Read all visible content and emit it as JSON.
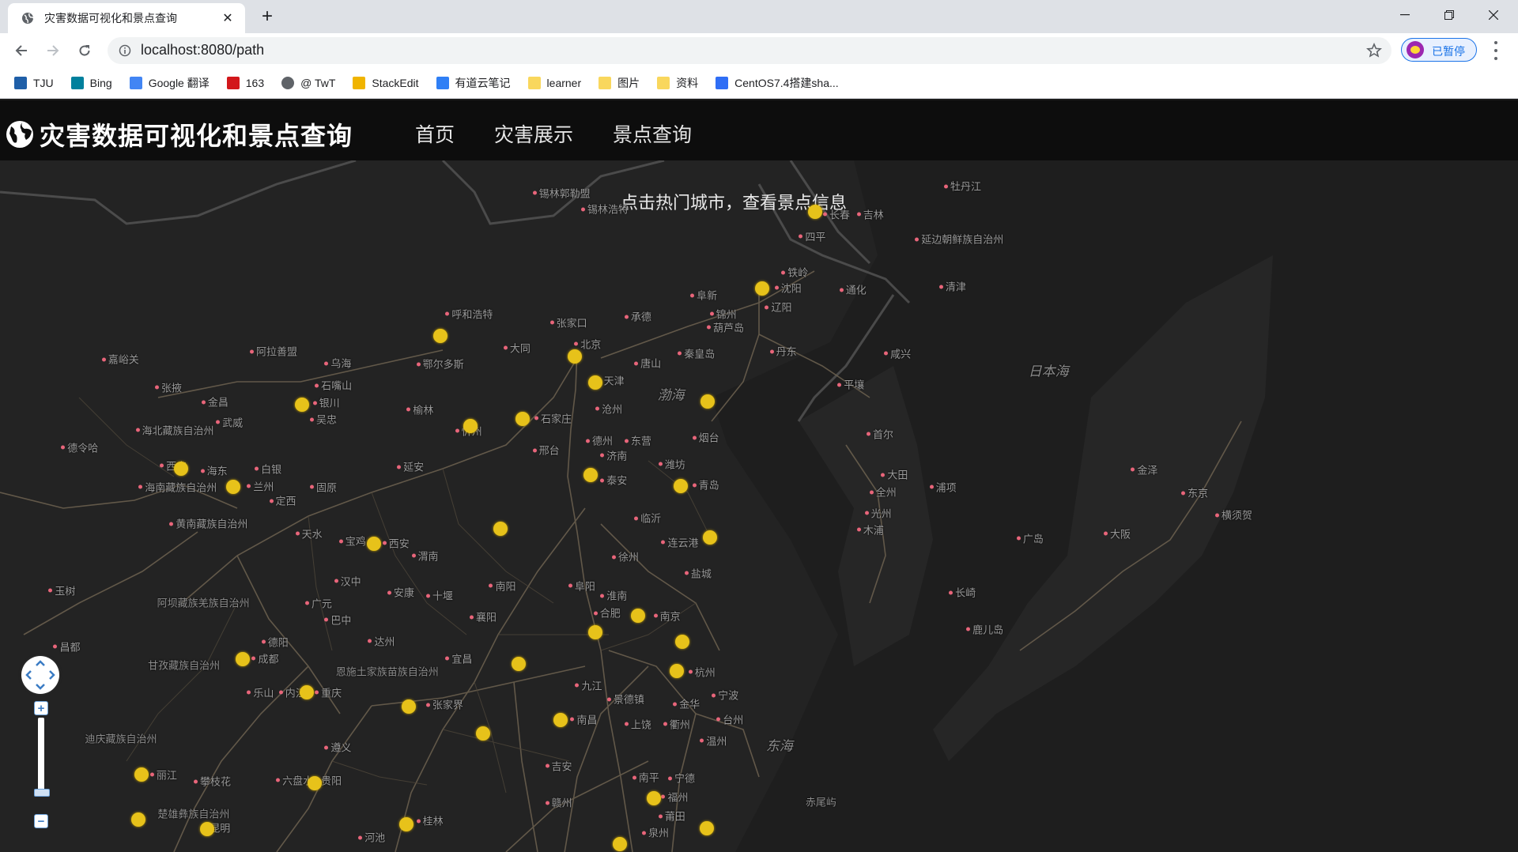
{
  "browser": {
    "tab_title": "灾害数据可视化和景点查询",
    "new_tab_label": "+",
    "url": "localhost:8080/path",
    "profile_label": "已暂停",
    "bookmarks": [
      {
        "label": "TJU",
        "icon": "tju-icon"
      },
      {
        "label": "Bing",
        "icon": "bing-icon"
      },
      {
        "label": "Google 翻译",
        "icon": "google-translate-icon"
      },
      {
        "label": "163",
        "icon": "netease-icon"
      },
      {
        "label": "@ TwT",
        "icon": "globe-icon"
      },
      {
        "label": "StackEdit",
        "icon": "stackedit-icon"
      },
      {
        "label": "有道云笔记",
        "icon": "youdao-note-icon"
      },
      {
        "label": "learner",
        "icon": "folder-icon"
      },
      {
        "label": "图片",
        "icon": "folder-icon"
      },
      {
        "label": "资料",
        "icon": "folder-icon"
      },
      {
        "label": "CentOS7.4搭建sha...",
        "icon": "bookmark-page-icon"
      }
    ]
  },
  "app": {
    "title": "灾害数据可视化和景点查询",
    "nav": [
      "首页",
      "灾害展示",
      "景点查询"
    ]
  },
  "map": {
    "title": "点击热门城市，查看景点信息",
    "hot_city_color": "#e7c21a",
    "labels": [
      "锡林郭勒盟",
      "锡林浩特",
      "长春",
      "吉林",
      "牡丹江",
      "延边朝鲜族自治州",
      "铁岭",
      "四平",
      "沈阳",
      "通化",
      "清津",
      "辽阳",
      "阜新",
      "锦州",
      "葫芦岛",
      "承德",
      "张家口",
      "呼和浩特",
      "鄂尔多斯",
      "乌海",
      "阿拉善盟",
      "嘉峪关",
      "张掖",
      "金昌",
      "武威",
      "石嘴山",
      "银川",
      "吴忠",
      "海北藏族自治州",
      "德令哈",
      "西宁",
      "海东",
      "兰州",
      "白银",
      "定西",
      "海南藏族自治州",
      "固原",
      "黄南藏族自治州",
      "天水",
      "宝鸡",
      "西安",
      "渭南",
      "延安",
      "榆林",
      "忻州",
      "大同",
      "北京",
      "天津",
      "唐山",
      "秦皇岛",
      "石家庄",
      "沧州",
      "邢台",
      "德州",
      "东营",
      "烟台",
      "济南",
      "潍坊",
      "青岛",
      "泰安",
      "临沂",
      "连云港",
      "徐州",
      "盐城",
      "南京",
      "合肥",
      "杭州",
      "宁波",
      "台州",
      "温州",
      "金华",
      "衢州",
      "宁德",
      "福州",
      "莆田",
      "泉州",
      "南平",
      "上饶",
      "景德镇",
      "南昌",
      "九江",
      "吉安",
      "赣州",
      "张家界",
      "宜昌",
      "襄阳",
      "十堰",
      "南阳",
      "阜阳",
      "淮南",
      "汉中",
      "安康",
      "达州",
      "广元",
      "巴中",
      "德阳",
      "成都",
      "内江",
      "乐山",
      "重庆",
      "遵义",
      "六盘水",
      "贵阳",
      "攀枝花",
      "丽江",
      "昆明",
      "玉树",
      "昌都",
      "桂林",
      "河池",
      "平壤",
      "咸兴",
      "首尔",
      "大田",
      "全州",
      "光州",
      "木浦",
      "浦项",
      "金泽",
      "东京",
      "横须贺",
      "大阪",
      "广岛",
      "长崎",
      "鹿儿岛",
      "丹东"
    ],
    "regions": [
      "阿坝藏族羌族自治州",
      "甘孜藏族自治州",
      "恩施土家族苗族自治州",
      "迪庆藏族自治州",
      "楚雄彝族自治州",
      "赤尾屿"
    ],
    "seas": [
      "渤海",
      "日本海",
      "东海"
    ]
  }
}
